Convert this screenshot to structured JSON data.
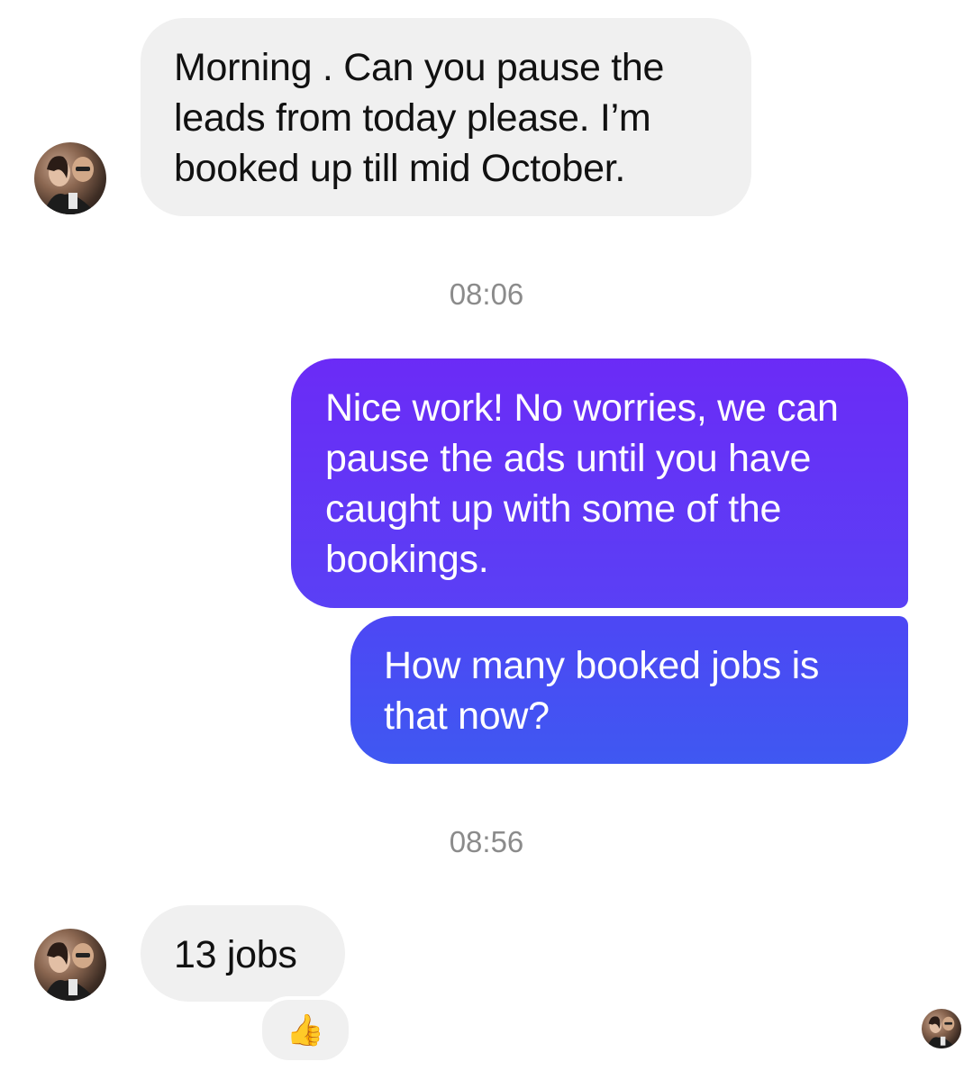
{
  "conversation": {
    "messages": [
      {
        "sender": "contact",
        "text": "Morning . Can you pause the leads from today please. I’m booked up till mid October."
      },
      {
        "sender": "me",
        "text": "Nice work! No worries, we can pause the ads until you have caught up with some of the bookings."
      },
      {
        "sender": "me",
        "text": "How many booked jobs is that now?"
      },
      {
        "sender": "contact",
        "text": "13 jobs"
      }
    ],
    "timestamps": [
      "08:06",
      "08:56"
    ],
    "reaction": {
      "emoji": "👍",
      "icon": "thumbs-up-icon"
    }
  },
  "colors": {
    "incoming_bubble": "#f0f0f0",
    "outgoing_gradient_top": "#6b2bf6",
    "outgoing_gradient_bottom": "#3f58f2",
    "timestamp_text": "#8b8b8b"
  }
}
